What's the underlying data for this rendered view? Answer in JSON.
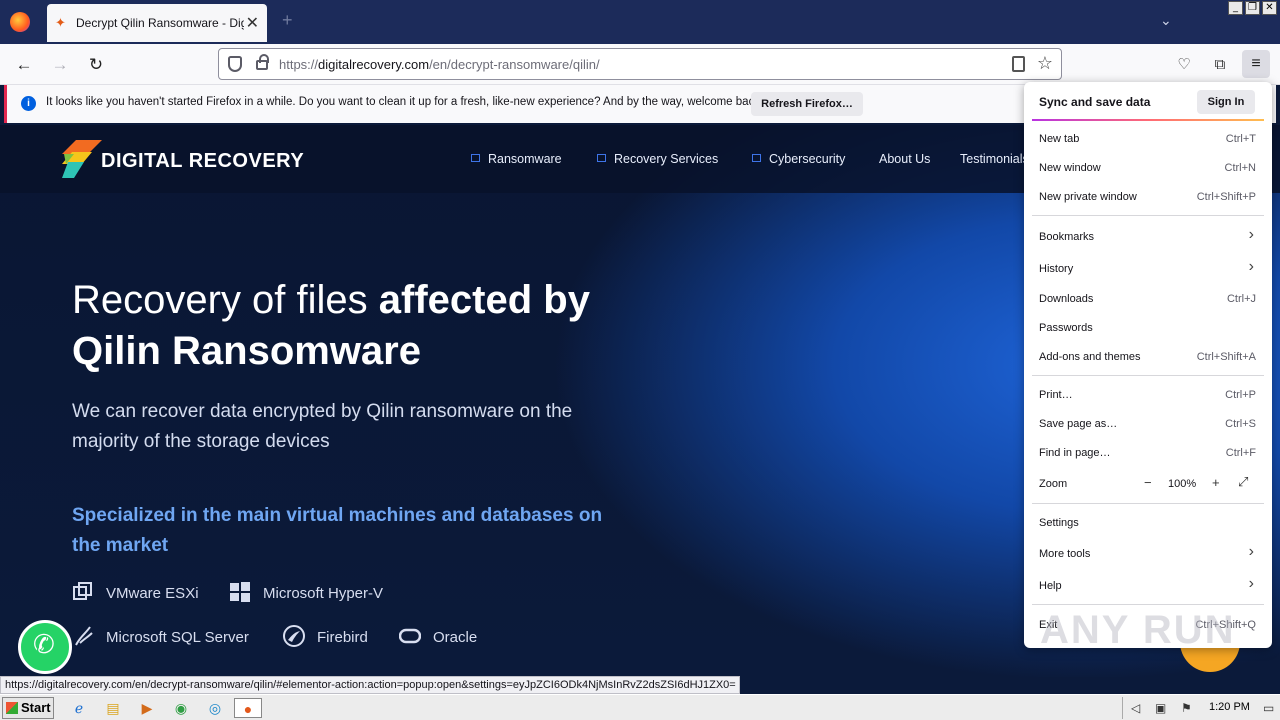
{
  "browser": {
    "tab_title": "Decrypt Qilin Ransomware - Digital Recovery",
    "url_prefix": "https://",
    "url_host": "digitalrecovery.com",
    "url_path": "/en/decrypt-ransomware/qilin/"
  },
  "notification": {
    "text": "It looks like you haven't started Firefox in a while. Do you want to clean it up for a fresh, like-new experience? And by the way, welcome back!",
    "button": "Refresh Firefox…"
  },
  "site": {
    "logo": "DIGITAL RECOVERY",
    "nav": [
      "Ransomware",
      "Recovery Services",
      "Cybersecurity",
      "About Us",
      "Testimonials"
    ],
    "hero_light": "Recovery of files ",
    "hero_bold1": "affected by",
    "hero_bold2": "Qilin Ransomware",
    "subtitle": "We can recover data encrypted by Qilin ransomware on the majority of the storage devices",
    "specialized": "Specialized in the main virtual machines and databases on the market",
    "tech": [
      "VMware ESXi",
      "Microsoft Hyper-V",
      "Microsoft SQL Server",
      "Firebird",
      "Oracle"
    ]
  },
  "app_menu": {
    "sync": "Sync and save data",
    "sign_in": "Sign In",
    "items": [
      {
        "label": "New tab",
        "shortcut": "Ctrl+T"
      },
      {
        "label": "New window",
        "shortcut": "Ctrl+N"
      },
      {
        "label": "New private window",
        "shortcut": "Ctrl+Shift+P"
      },
      {
        "label": "Bookmarks",
        "shortcut": ""
      },
      {
        "label": "History",
        "shortcut": ""
      },
      {
        "label": "Downloads",
        "shortcut": "Ctrl+J"
      },
      {
        "label": "Passwords",
        "shortcut": ""
      },
      {
        "label": "Add-ons and themes",
        "shortcut": "Ctrl+Shift+A"
      },
      {
        "label": "Print…",
        "shortcut": "Ctrl+P"
      },
      {
        "label": "Save page as…",
        "shortcut": "Ctrl+S"
      },
      {
        "label": "Find in page…",
        "shortcut": "Ctrl+F"
      },
      {
        "label": "Zoom",
        "shortcut": ""
      },
      {
        "label": "Settings",
        "shortcut": ""
      },
      {
        "label": "More tools",
        "shortcut": ""
      },
      {
        "label": "Help",
        "shortcut": ""
      },
      {
        "label": "Exit",
        "shortcut": "Ctrl+Shift+Q"
      }
    ],
    "zoom_value": "100%",
    "zoom_minus": "−",
    "zoom_plus": "+"
  },
  "status_link": "https://digitalrecovery.com/en/decrypt-ransomware/qilin/#elementor-action:action=popup:open&settings=eyJpZCI6ODk4NjMsInRvZ2dsZSI6dHJ1ZX0=",
  "watermark": "ANY RUN",
  "taskbar": {
    "start": "Start",
    "clock": "1:20 PM"
  },
  "colors": {
    "accent": "#0060df",
    "hero_blue": "#1e63d6",
    "spec_blue": "#6fa6f2",
    "whatsapp": "#25d366"
  }
}
